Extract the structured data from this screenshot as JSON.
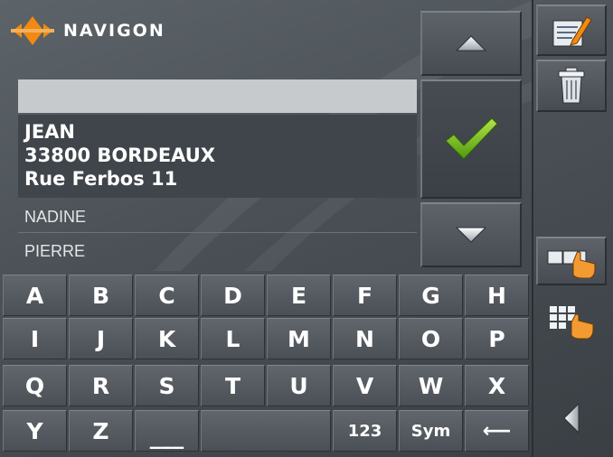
{
  "app": {
    "logo_text": "NAVIGON"
  },
  "search": {
    "input_value": ""
  },
  "results": {
    "selected": {
      "line1": "JEAN",
      "line2": "33800 BORDEAUX",
      "line3": "Rue Ferbos 11"
    },
    "items": [
      {
        "label": "NADINE"
      },
      {
        "label": "PIERRE"
      }
    ]
  },
  "keyboard": {
    "rows": [
      [
        "A",
        "B",
        "C",
        "D",
        "E",
        "F",
        "G",
        "H"
      ],
      [
        "I",
        "J",
        "K",
        "L",
        "M",
        "N",
        "O",
        "P"
      ],
      [
        "Q",
        "R",
        "S",
        "T",
        "U",
        "V",
        "W",
        "X"
      ]
    ],
    "last_row": {
      "y": "Y",
      "z": "Z",
      "space": "___",
      "numbers": "123",
      "symbols": "Sym",
      "backspace": "⟵"
    }
  },
  "icons": {
    "logo": "navigon-diamond-icon",
    "scroll_up": "triangle-up-icon",
    "scroll_down": "triangle-down-icon",
    "confirm": "checkmark-icon",
    "edit": "edit-note-icon",
    "delete": "trash-icon",
    "abc_keyboard": "abc-keyboard-icon",
    "grid_keyboard": "grid-keyboard-icon",
    "back": "triangle-left-icon"
  },
  "colors": {
    "accent_orange": "#f08a12",
    "check_green": "#7fc21b",
    "background": "#4a5056"
  }
}
